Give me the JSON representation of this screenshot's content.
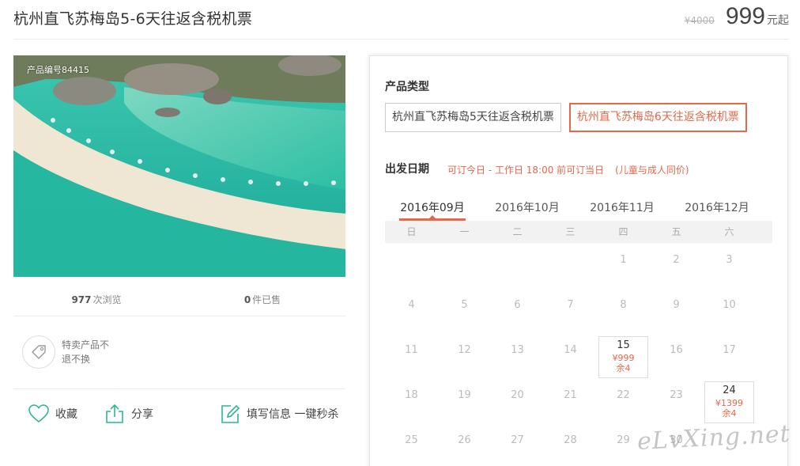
{
  "header": {
    "title": "杭州直飞苏梅岛5-6天往返含税机票",
    "old_price": "¥4000",
    "price": "999",
    "price_unit": "元起"
  },
  "photo": {
    "product_code": "产品编号84415",
    "alt": "苏梅岛海滩"
  },
  "stats": {
    "views_count": "977",
    "views_label": "次浏览",
    "sold_count": "0",
    "sold_label": "件已售"
  },
  "policy": {
    "line1": "特卖产品不",
    "line2": "退不换"
  },
  "actions": {
    "favorite": "收藏",
    "share": "分享",
    "fill_info": "填写信息 一键秒杀"
  },
  "booking": {
    "type_label": "产品类型",
    "types": [
      "杭州直飞苏梅岛5天往返含税机票",
      "杭州直飞苏梅岛6天往返含税机票"
    ],
    "date_label": "出发日期",
    "date_note": "可订今日 - 工作日 18:00 前可订当日",
    "date_note2": "(儿童与成人同价)",
    "months": [
      "2016年09月",
      "2016年10月",
      "2016年11月",
      "2016年12月"
    ],
    "weekdays": [
      "日",
      "一",
      "二",
      "三",
      "四",
      "五",
      "六"
    ],
    "weeks": [
      [
        "",
        "",
        "",
        "",
        "1",
        "2",
        "3"
      ],
      [
        "4",
        "5",
        "6",
        "7",
        "8",
        "9",
        "10"
      ],
      [
        "11",
        "12",
        "13",
        "14",
        "15",
        "16",
        "17"
      ],
      [
        "18",
        "19",
        "20",
        "21",
        "22",
        "23",
        "24"
      ],
      [
        "25",
        "26",
        "27",
        "28",
        "29",
        "30",
        ""
      ]
    ],
    "day15": {
      "day": "15",
      "price": "¥999",
      "remain": "余4"
    },
    "day24": {
      "day": "24",
      "price": "¥1399",
      "remain": "余4"
    }
  },
  "watermark": "eLvXing.net",
  "colors": {
    "accent": "#e5684b",
    "icon_green": "#2fb58f"
  }
}
